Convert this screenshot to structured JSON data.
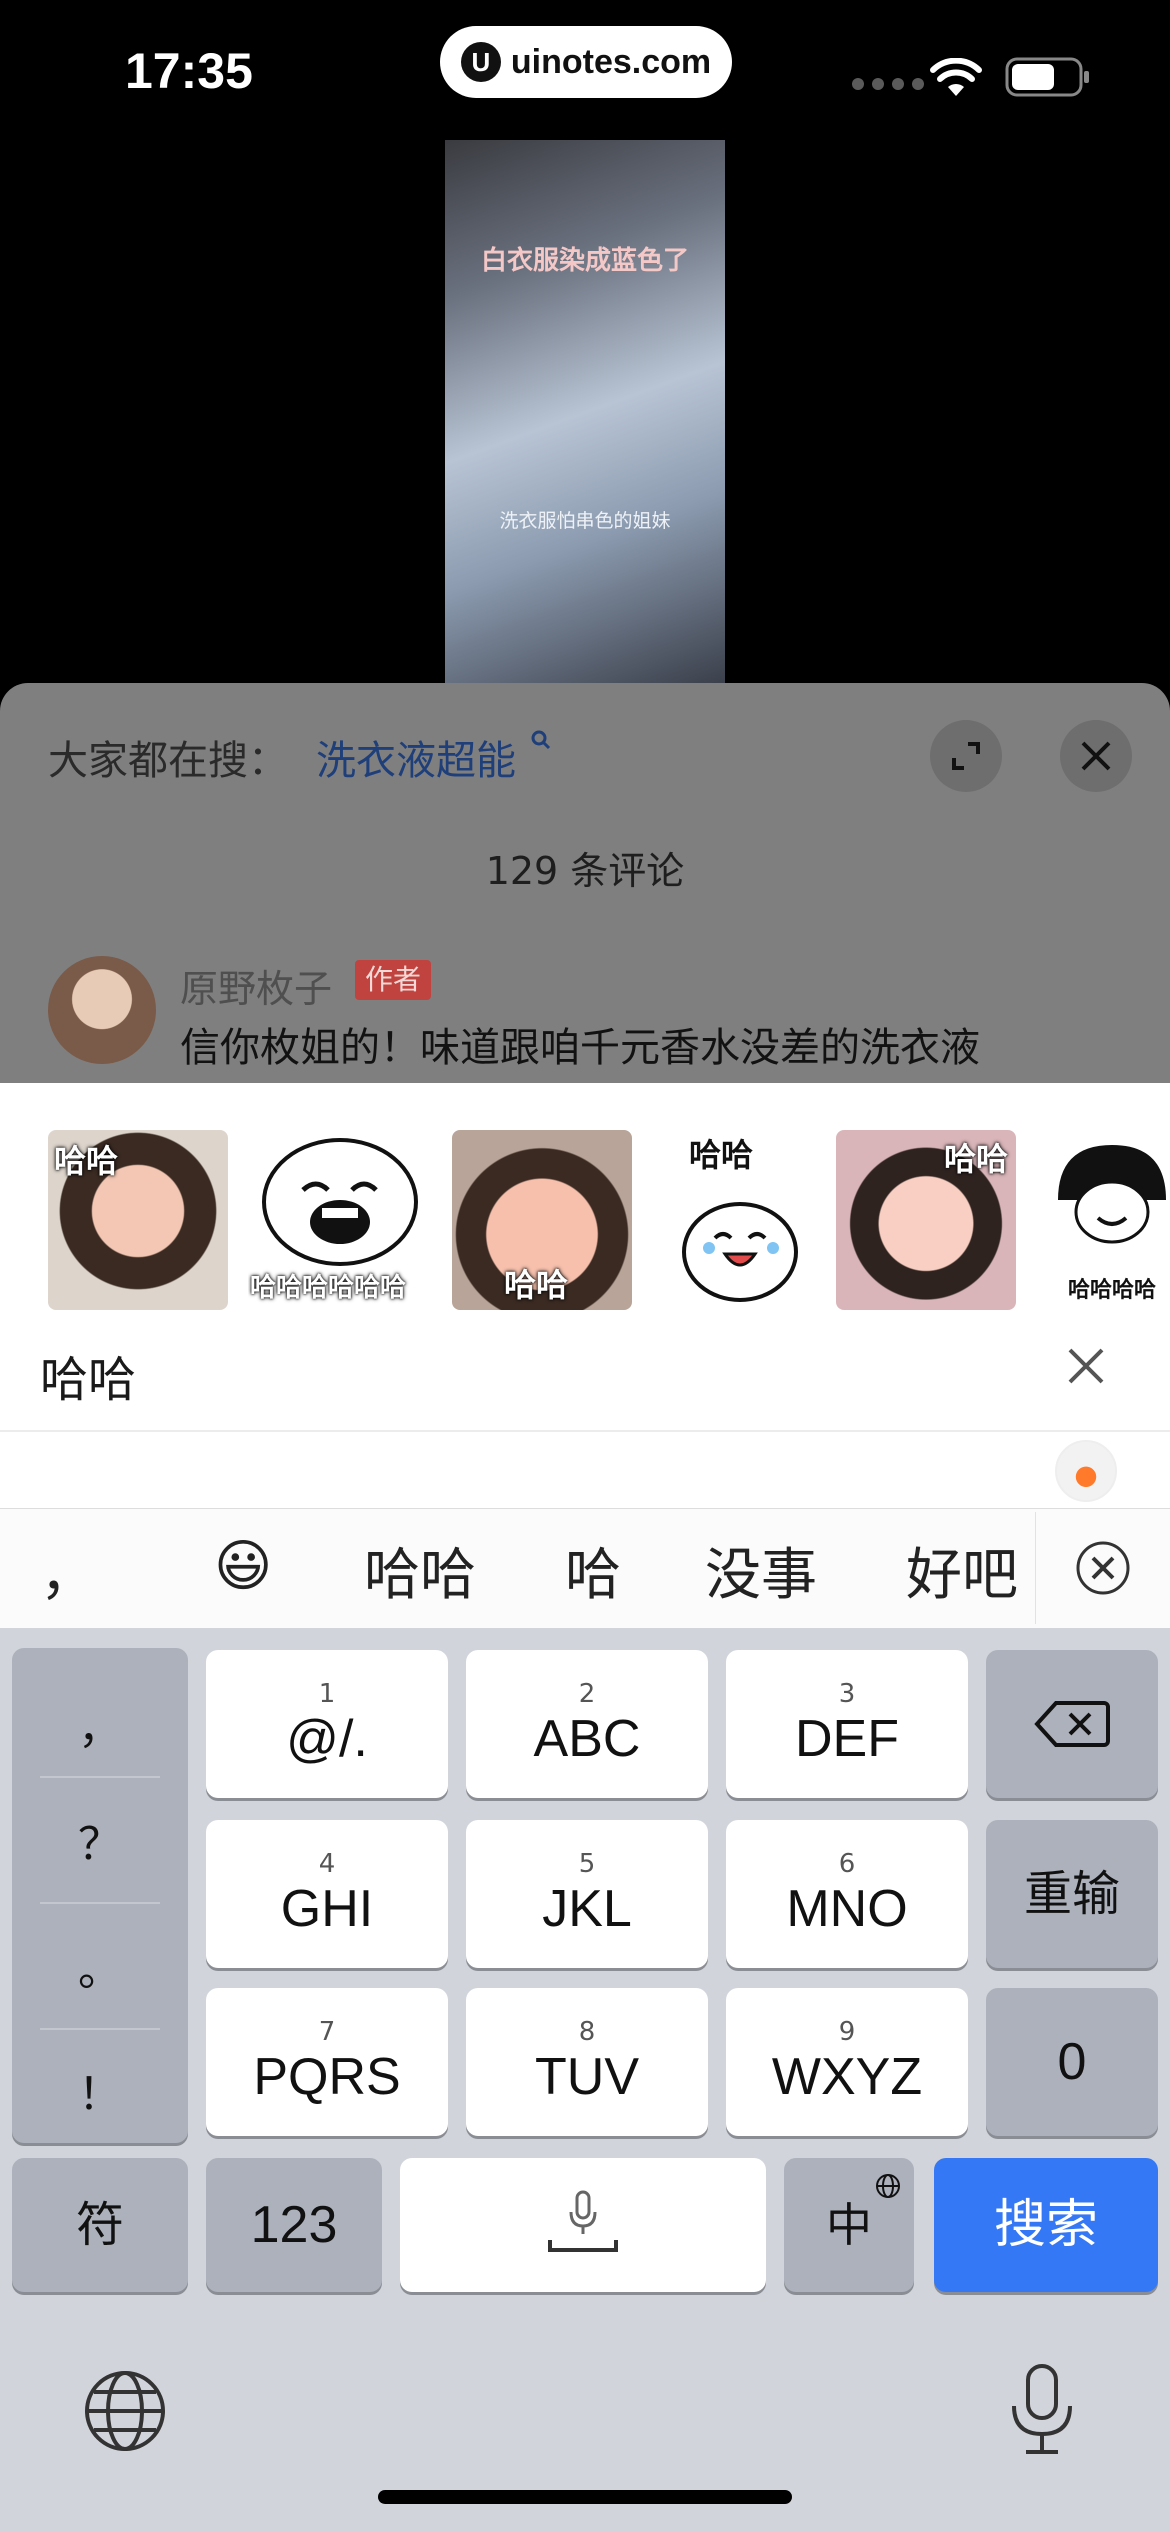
{
  "status_bar": {
    "time": "17:35",
    "url": "uinotes.com",
    "logo_letter": "U"
  },
  "video": {
    "caption": "白衣服染成蓝色了",
    "subcaption": "洗衣服怕串色的姐妹"
  },
  "comment_sheet": {
    "hot_search_label": "大家都在搜：",
    "hot_search_term": "洗衣液超能",
    "comment_count": "129 条评论",
    "comment": {
      "user": "原野枚子",
      "badge": "作者",
      "text": "信你枚姐的！味道跟咱千元香水没差的洗衣液"
    }
  },
  "stickers": {
    "labels": [
      "哈哈",
      "哈哈哈哈哈哈",
      "哈哈",
      "哈哈",
      "哈哈",
      "哈哈哈哈"
    ],
    "query": "哈哈"
  },
  "candidates": [
    "，",
    "😃",
    "哈哈",
    "哈",
    "没事",
    "好吧"
  ],
  "keyboard": {
    "punctuation": [
      "，",
      "？",
      "。",
      "！"
    ],
    "keys": [
      {
        "num": "1",
        "label": "@/."
      },
      {
        "num": "2",
        "label": "ABC"
      },
      {
        "num": "3",
        "label": "DEF"
      },
      {
        "num": "4",
        "label": "GHI"
      },
      {
        "num": "5",
        "label": "JKL"
      },
      {
        "num": "6",
        "label": "MNO"
      },
      {
        "num": "7",
        "label": "PQRS"
      },
      {
        "num": "8",
        "label": "TUV"
      },
      {
        "num": "9",
        "label": "WXYZ"
      }
    ],
    "retype": "重输",
    "zero": "0",
    "symbols": "符",
    "numbers": "123",
    "lang": "中",
    "search": "搜索"
  }
}
